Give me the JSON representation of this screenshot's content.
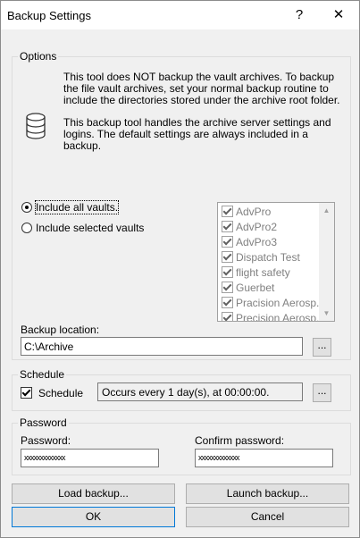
{
  "window": {
    "title": "Backup Settings",
    "help_label": "?",
    "close_label": "✕"
  },
  "options": {
    "group_label": "Options",
    "info1": "This tool does NOT backup the vault archives. To backup the file vault archives, set your normal backup routine to include the directories stored under the archive root folder.",
    "info2": "This backup tool handles the archive server settings and logins. The default settings are always included in a backup.",
    "radio_all": "Include all vaults.",
    "radio_selected": "Include selected vaults",
    "radio_selected_value": "all",
    "vaults": [
      {
        "label": "AdvPro",
        "checked": true
      },
      {
        "label": "AdvPro2",
        "checked": true
      },
      {
        "label": "AdvPro3",
        "checked": true
      },
      {
        "label": "Dispatch Test",
        "checked": true
      },
      {
        "label": "flight safety",
        "checked": true
      },
      {
        "label": "Guerbet",
        "checked": true
      },
      {
        "label": "Pracision Aerosp...",
        "checked": true
      },
      {
        "label": "Precision Aerosp...",
        "checked": true
      }
    ],
    "backup_location_label": "Backup location:",
    "backup_location_value": "C:\\Archive",
    "browse_label": "..."
  },
  "schedule": {
    "group_label": "Schedule",
    "checkbox_label": "Schedule",
    "checked": true,
    "summary": "Occurs every 1 day(s), at 00:00:00.",
    "edit_label": "..."
  },
  "password": {
    "group_label": "Password",
    "password_label": "Password:",
    "password_value": "xxxxxxxxxxxxx",
    "confirm_label": "Confirm password:",
    "confirm_value": "xxxxxxxxxxxxx"
  },
  "buttons": {
    "load_backup": "Load backup...",
    "launch_backup": "Launch backup...",
    "ok": "OK",
    "cancel": "Cancel"
  }
}
